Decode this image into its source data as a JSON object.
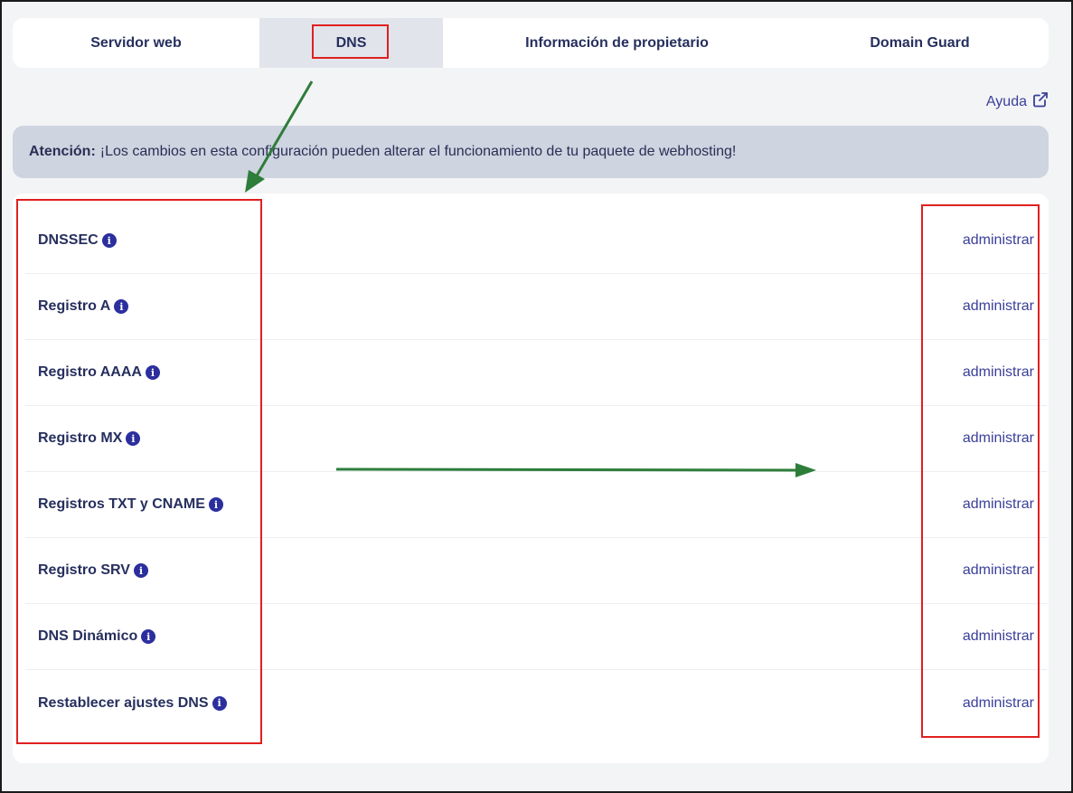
{
  "tabs": [
    {
      "label": "Servidor web"
    },
    {
      "label": "DNS"
    },
    {
      "label": "Información de propietario"
    },
    {
      "label": "Domain Guard"
    }
  ],
  "help": {
    "label": "Ayuda",
    "icon": "external-link-icon"
  },
  "alert": {
    "prefix": "Atención:",
    "message": "¡Los cambios en esta configuración pueden alterar el funcionamiento de tu paquete de webhosting!"
  },
  "records": [
    {
      "label": "DNSSEC",
      "action": "administrar"
    },
    {
      "label": "Registro A",
      "action": "administrar"
    },
    {
      "label": "Registro AAAA",
      "action": "administrar"
    },
    {
      "label": "Registro MX",
      "action": "administrar"
    },
    {
      "label": "Registros TXT y CNAME",
      "action": "administrar"
    },
    {
      "label": "Registro SRV",
      "action": "administrar"
    },
    {
      "label": "DNS Dinámico",
      "action": "administrar"
    },
    {
      "label": "Restablecer ajustes DNS",
      "action": "administrar"
    }
  ],
  "colors": {
    "accent": "#3a3f9a",
    "annotation_red": "#e02020",
    "annotation_green": "#2e7d3a",
    "alert_bg": "#ced4e0"
  }
}
